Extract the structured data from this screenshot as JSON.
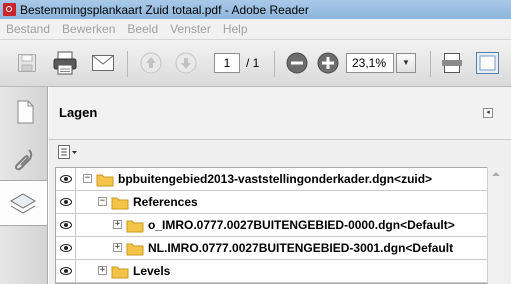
{
  "window": {
    "title": "Bestemmingsplankaart Zuid totaal.pdf - Adobe Reader"
  },
  "menu": {
    "items": [
      "Bestand",
      "Bewerken",
      "Beeld",
      "Venster",
      "Help"
    ]
  },
  "toolbar": {
    "page_current": "1",
    "page_total": "/ 1",
    "zoom": "23,1%",
    "icons": [
      "save-icon",
      "print-icon",
      "email-icon",
      "previous-page-icon",
      "next-page-icon",
      "zoom-out-icon",
      "zoom-in-icon",
      "fit-page-icon",
      "fit-width-icon"
    ]
  },
  "nav": {
    "buttons": [
      "pages-icon",
      "attachments-icon",
      "layers-icon"
    ],
    "active": "layers-icon"
  },
  "layers_panel": {
    "title": "Lagen",
    "rows": [
      {
        "label": "bpbuitengebied2013-vaststellingonderkader.dgn<zuid>",
        "expander": "−",
        "indent": 0
      },
      {
        "label": "References",
        "expander": "−",
        "indent": 1
      },
      {
        "label": "o_IMRO.0777.0027BUITENGEBIED-0000.dgn<Default>",
        "expander": "+",
        "indent": 2
      },
      {
        "label": "NL.IMRO.0777.0027BUITENGEBIED-3001.dgn<Default",
        "expander": "+",
        "indent": 2
      },
      {
        "label": "Levels",
        "expander": "+",
        "indent": 1
      }
    ]
  },
  "colors": {
    "folder": "#f3c447",
    "titlebar": "#9fc2e5",
    "disabled_text": "#a0a0a0"
  }
}
